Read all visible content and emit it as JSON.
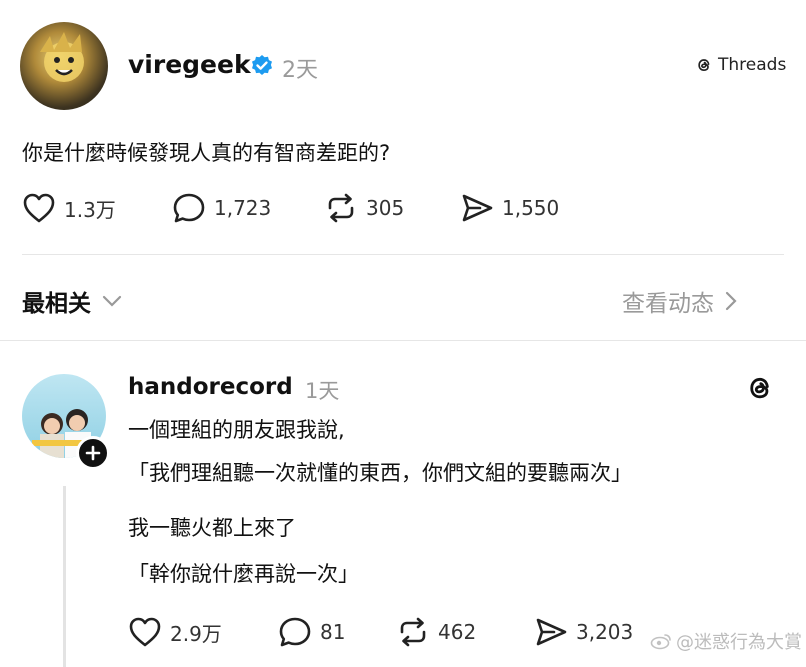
{
  "post": {
    "username": "viregeek",
    "time": "2天",
    "brand": "Threads",
    "text": "你是什麼時候發現人真的有智商差距的?",
    "stats": {
      "likes": "1.3万",
      "replies": "1,723",
      "reposts": "305",
      "shares": "1,550"
    }
  },
  "sort_bar": {
    "label": "最相关",
    "activity_link": "查看动态"
  },
  "reply": {
    "username": "handorecord",
    "time": "1天",
    "lines": [
      "一個理組的朋友跟我說,",
      "「我們理組聽一次就懂的東西，你們文組的要聽兩次」",
      "我一聽火都上來了",
      "「幹你說什麼再說一次」"
    ],
    "stats": {
      "likes": "2.9万",
      "replies": "81",
      "reposts": "462",
      "shares": "3,203"
    }
  },
  "watermark": "@迷惑行為大賞",
  "colors": {
    "verified": "#1d9bf0",
    "muted": "#9a9a9a",
    "text": "#111111"
  }
}
